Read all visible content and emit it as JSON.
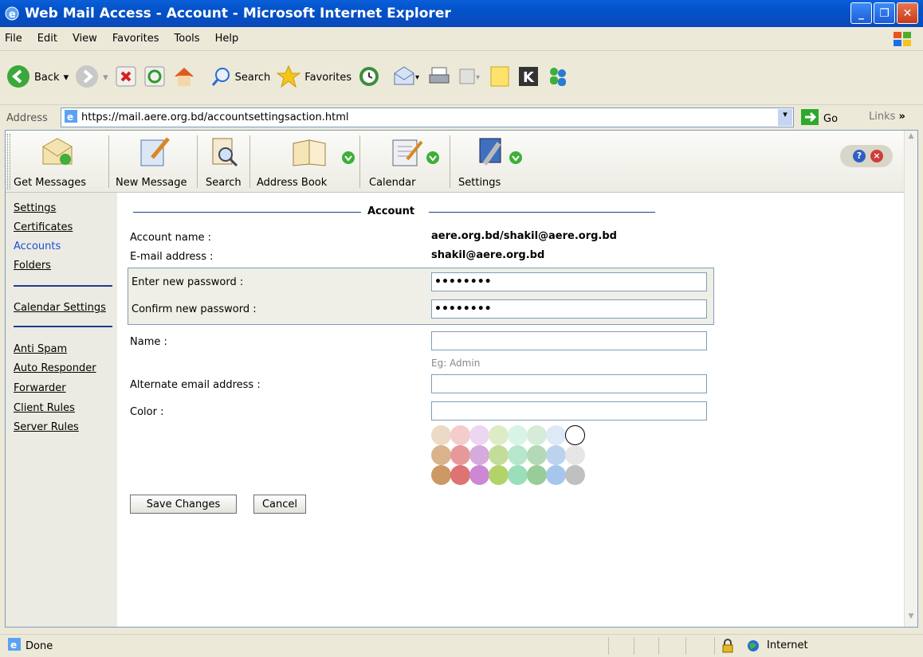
{
  "window": {
    "title": "Web Mail Access - Account - Microsoft Internet Explorer"
  },
  "menu": [
    "File",
    "Edit",
    "View",
    "Favorites",
    "Tools",
    "Help"
  ],
  "toolbar": {
    "back": "Back",
    "search": "Search",
    "favorites": "Favorites"
  },
  "address": {
    "label": "Address",
    "url": "https://mail.aere.org.bd/accountsettingsaction.html",
    "go": "Go",
    "links": "Links"
  },
  "app_toolbar": {
    "get_messages": "Get Messages",
    "new_message": "New Message",
    "search": "Search",
    "address_book": "Address Book",
    "calendar": "Calendar",
    "settings": "Settings"
  },
  "sidebar": {
    "settings": "Settings",
    "certificates": "Certificates",
    "accounts": "Accounts",
    "folders": "Folders",
    "calendar_settings": "Calendar Settings",
    "anti_spam": "Anti Spam",
    "auto_responder": "Auto Responder",
    "forwarder": "Forwarder",
    "client_rules": "Client Rules",
    "server_rules": "Server Rules"
  },
  "form": {
    "section_title": "Account",
    "account_name_label": "Account name :",
    "account_name_value": "aere.org.bd/shakil@aere.org.bd",
    "email_label": "E-mail address :",
    "email_value": "shakil@aere.org.bd",
    "new_password_label": "Enter new password :",
    "new_password_value": "••••••••",
    "confirm_password_label": "Confirm new password :",
    "confirm_password_value": "••••••••",
    "name_label": "Name :",
    "name_value": "",
    "name_hint": "Eg: Admin",
    "alt_email_label": "Alternate email address :",
    "alt_email_value": "",
    "color_label": "Color :",
    "color_value": "",
    "save_button": "Save Changes",
    "cancel_button": "Cancel"
  },
  "palette": [
    [
      "#ecd9c6",
      "#f3cccc",
      "#ecd6f0",
      "#deecc6",
      "#d9f3e6",
      "#d6ecd9",
      "#dde9f6",
      "#ffffff"
    ],
    [
      "#d9b38c",
      "#e69999",
      "#d6aadc",
      "#c3dc99",
      "#b6e6cc",
      "#b3d9b9",
      "#bbd3ed",
      "#e6e6e6"
    ],
    [
      "#cc9966",
      "#de7373",
      "#cc88d3",
      "#b2d36a",
      "#99dfb9",
      "#99cc99",
      "#a6c6ed",
      "#c0c0c0"
    ]
  ],
  "status": {
    "text": "Done",
    "zone": "Internet"
  }
}
